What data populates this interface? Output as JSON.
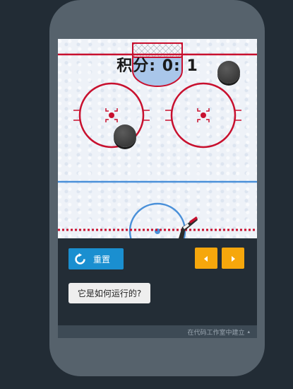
{
  "game": {
    "score_text": "积分: 0: 1"
  },
  "controls": {
    "reset_label": "重置",
    "how_label": "它是如何运行的?"
  },
  "footer": {
    "text": "在代码工作室中建立",
    "caret": "▴"
  },
  "colors": {
    "red_line": "#c8102e",
    "blue_line": "#4a90d9",
    "reset_button": "#1a8fd0",
    "arrow_button": "#f6a70c"
  },
  "icons": [
    "refresh-icon",
    "arrow-left-icon",
    "arrow-right-icon",
    "hockey-stick-icon",
    "caret-up-icon"
  ]
}
